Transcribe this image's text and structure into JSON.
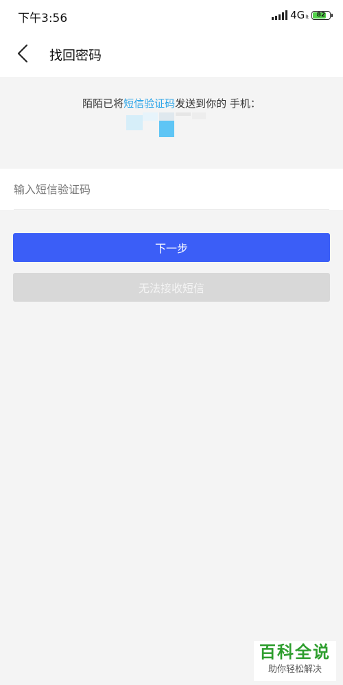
{
  "status_bar": {
    "time": "下午3:56",
    "network": "4G",
    "network_sub": "lt",
    "battery_level": "82"
  },
  "nav": {
    "back_icon": "chevron-left-icon",
    "title": "找回密码"
  },
  "info": {
    "text_before": "陌陌已将",
    "text_link": "短信验证码",
    "text_after": "发送到你的 手机：",
    "link_color": "#2aa4e8"
  },
  "code_input": {
    "placeholder": "输入短信验证码",
    "value": ""
  },
  "buttons": {
    "next_label": "下一步",
    "cannot_receive_label": "无法接收短信"
  },
  "watermark": {
    "title": "百科全说",
    "subtitle": "助你轻松解决"
  },
  "colors": {
    "primary": "#3b5ef7",
    "disabled": "#d8d8d8",
    "background": "#f4f4f4"
  }
}
